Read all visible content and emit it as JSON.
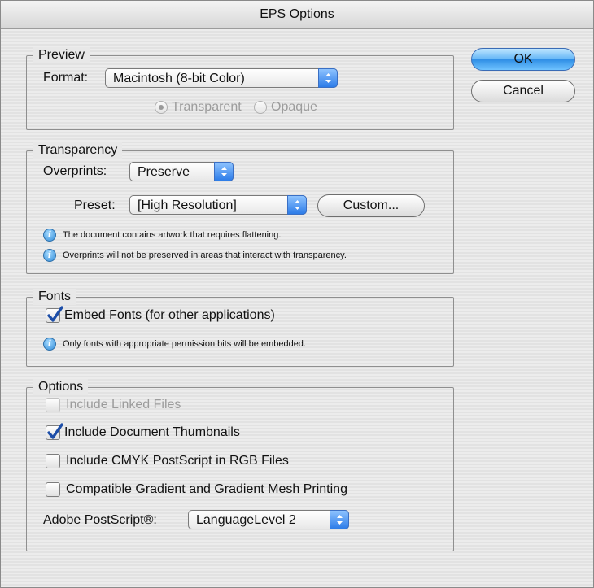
{
  "window": {
    "title": "EPS Options"
  },
  "buttons": {
    "ok": "OK",
    "cancel": "Cancel"
  },
  "preview": {
    "legend": "Preview",
    "format_label": "Format:",
    "format_value": "Macintosh (8-bit Color)",
    "radio_transparent": "Transparent",
    "radio_opaque": "Opaque",
    "selected_radio": "Transparent"
  },
  "transparency": {
    "legend": "Transparency",
    "overprints_label": "Overprints:",
    "overprints_value": "Preserve",
    "preset_label": "Preset:",
    "preset_value": "[High Resolution]",
    "custom_button": "Custom...",
    "info1": "The document contains artwork that requires flattening.",
    "info2": "Overprints will not be preserved in areas that interact with transparency."
  },
  "fonts": {
    "legend": "Fonts",
    "embed_label": "Embed Fonts (for other applications)",
    "embed_checked": true,
    "info": "Only fonts with appropriate permission bits will be embedded."
  },
  "options": {
    "legend": "Options",
    "include_linked": "Include Linked Files",
    "include_linked_checked": false,
    "include_thumbnails": "Include Document Thumbnails",
    "include_thumbnails_checked": true,
    "include_cmyk": "Include CMYK PostScript in RGB Files",
    "include_cmyk_checked": false,
    "compatible_gradient": "Compatible Gradient and Gradient Mesh Printing",
    "compatible_gradient_checked": false,
    "postscript_label": "Adobe PostScript®:",
    "postscript_value": "LanguageLevel 2"
  },
  "colors": {
    "accent": "#2f8ee6",
    "check": "#1d4ea8"
  },
  "icons": {
    "popup_arrows": "updown-arrows-icon",
    "info": "info-icon",
    "checkmark": "checkmark-icon"
  }
}
